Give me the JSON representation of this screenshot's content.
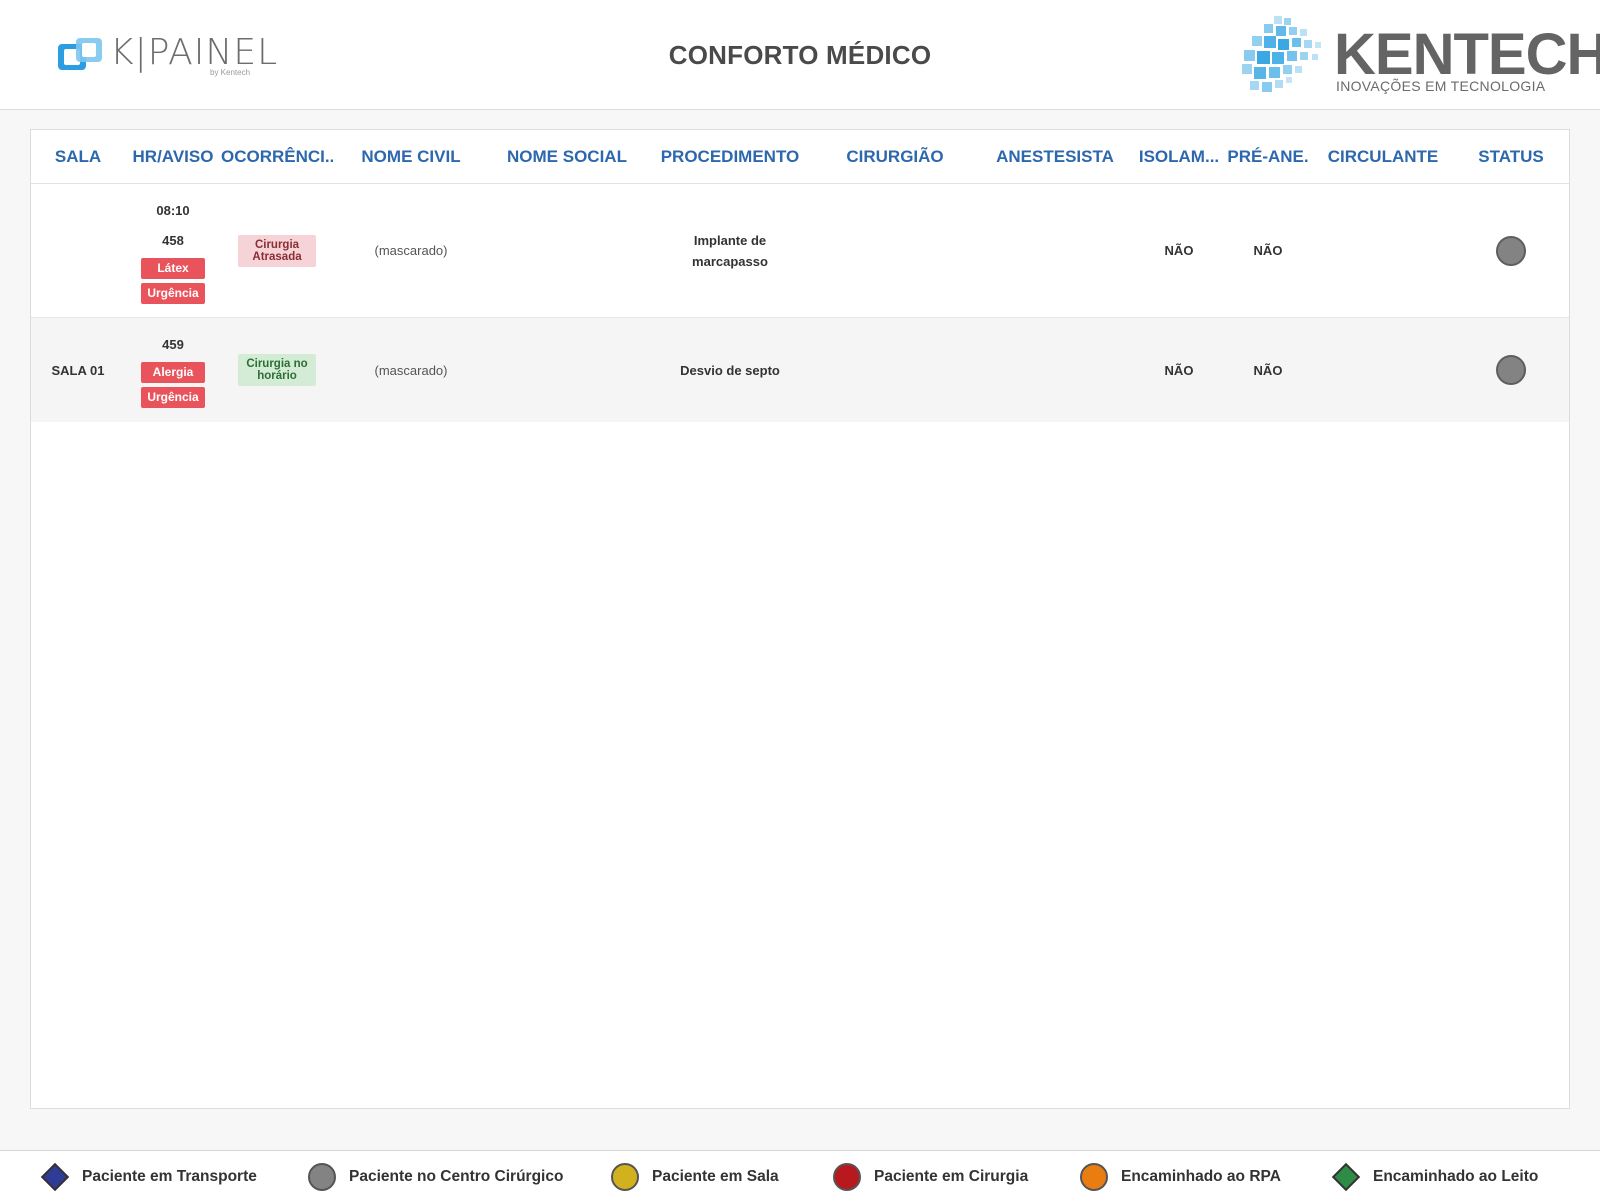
{
  "header": {
    "title": "CONFORTO MÉDICO",
    "left_logo": {
      "word": "K|PAINEL",
      "by_line": "by Kentech"
    },
    "right_logo": {
      "name": "KENTECH",
      "tagline": "INOVAÇÕES EM TECNOLOGIA"
    }
  },
  "table": {
    "columns": [
      "SALA",
      "HR/AVISO",
      "OCORRÊNCI...",
      "NOME CIVIL",
      "NOME SOCIAL",
      "PROCEDIMENTO",
      "CIRURGIÃO",
      "ANESTESISTA",
      "ISOLAM...",
      "PRÉ-ANE.",
      "CIRCULANTE",
      "STATUS"
    ],
    "rows": [
      {
        "sala": "",
        "hora": "08:10",
        "aviso": "458",
        "tags": [
          "Látex",
          "Urgência"
        ],
        "ocorrencia": "Cirurgia Atrasada",
        "nome_civil": "(mascarado)",
        "nome_social": "",
        "procedimento": "Implante de marcapasso",
        "cirurgiao": "",
        "anestesista": "",
        "isolamento": "NÃO",
        "pre_anestesia": "NÃO",
        "circulante": "",
        "status": "Paciente no Centro Cirúrgico"
      },
      {
        "sala": "SALA 01",
        "hora": "",
        "aviso": "459",
        "tags": [
          "Alergia",
          "Urgência"
        ],
        "ocorrencia": "Cirurgia no horário",
        "nome_civil": "(mascarado)",
        "nome_social": "",
        "procedimento": "Desvio de septo",
        "cirurgiao": "",
        "anestesista": "",
        "isolamento": "NÃO",
        "pre_anestesia": "NÃO",
        "circulante": "",
        "status": "Paciente no Centro Cirúrgico"
      }
    ]
  },
  "legend": [
    {
      "label": "Paciente em Transporte",
      "shape": "diamond-icon",
      "color": "#2e3b97"
    },
    {
      "label": "Paciente no Centro Cirúrgico",
      "shape": "circle-icon",
      "color": "#838383"
    },
    {
      "label": "Paciente em Sala",
      "shape": "circle-icon",
      "color": "#d1b21e"
    },
    {
      "label": "Paciente em Cirurgia",
      "shape": "circle-icon",
      "color": "#b8191f"
    },
    {
      "label": "Encaminhado ao RPA",
      "shape": "circle-icon",
      "color": "#ea7d12"
    },
    {
      "label": "Encaminhado ao Leito",
      "shape": "diamond-icon",
      "color": "#2f8c46"
    }
  ],
  "colors": {
    "header_text": "#2d67ad",
    "tag_red": "#e9545c",
    "late_bg": "#f6d3d6",
    "ontime_bg": "#d4ecd6"
  }
}
